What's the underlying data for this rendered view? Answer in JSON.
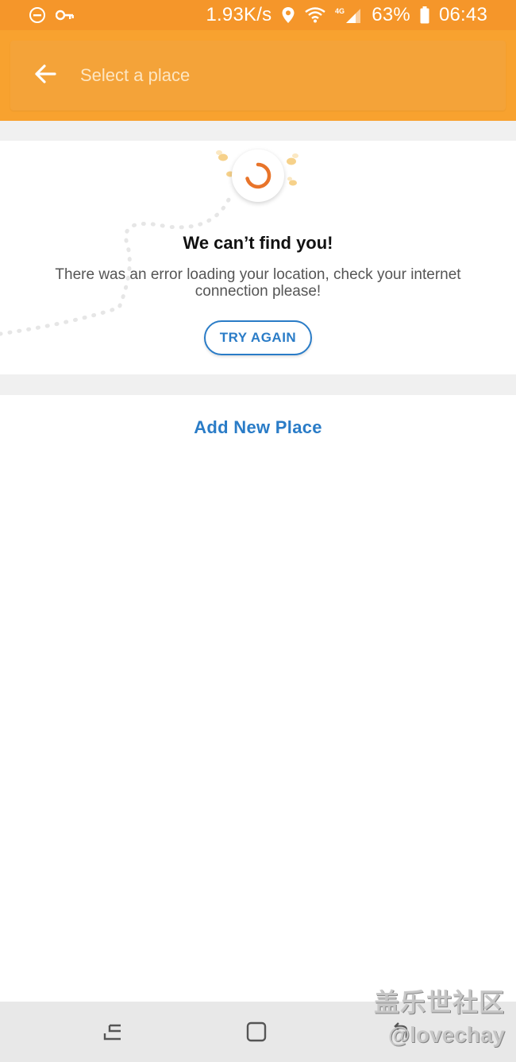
{
  "status_bar": {
    "network_speed": "1.93K/s",
    "network_type": "4G",
    "battery_percent": "63%",
    "time": "06:43",
    "icons": [
      "do-not-disturb-icon",
      "vpn-key-icon",
      "location-icon",
      "wifi-icon",
      "signal-icon",
      "battery-icon"
    ]
  },
  "header": {
    "search_placeholder": "Select a place",
    "back_icon": "arrow-left-icon"
  },
  "error": {
    "title": "We can’t find you!",
    "message": "There was an error loading your location, check your internet connection please!",
    "retry_label": "TRY AGAIN"
  },
  "actions": {
    "add_new_place": "Add New Place"
  },
  "watermark": {
    "line1": "盖乐世社区",
    "line2": "@lovechay"
  },
  "nav": [
    "recent-apps-icon",
    "home-icon",
    "back-icon"
  ],
  "colors": {
    "status_bar": "#f5962a",
    "header": "#f8a22f",
    "accent_blue": "#2a7cc7",
    "spinner": "#e8742a"
  }
}
